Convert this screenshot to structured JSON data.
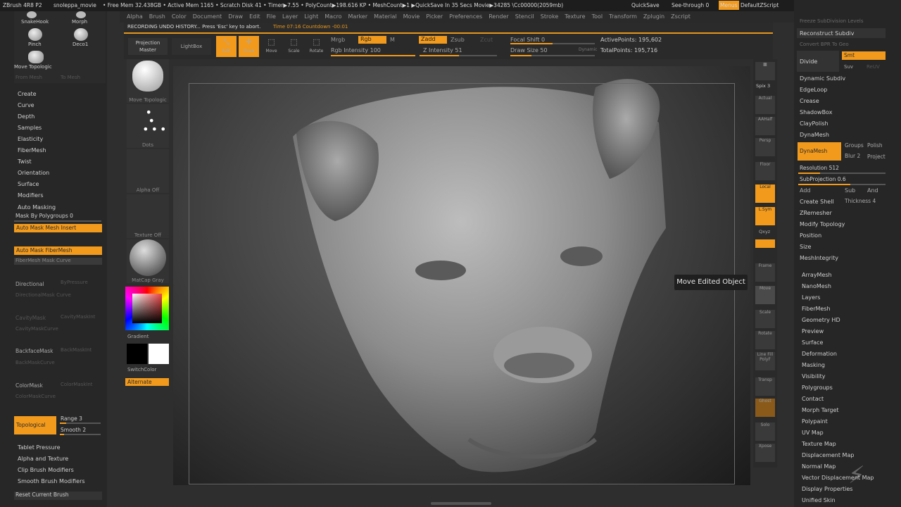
{
  "titlebar": {
    "app": "ZBrush 4R8 P2",
    "project": "snoleppa_movie",
    "stats": "• Free Mem 32.438GB • Active Mem 1165 • Scratch Disk 41 • Timer▶7.55 • PolyCount▶198.616 KP • MeshCount▶1 ▶QuickSave In 35 Secs Movie▶34285 \\Cc00000(2059mb)",
    "quicksave": "QuickSave",
    "see_through": "See-through 0",
    "menus": "Menus",
    "zscript": "DefaultZScript"
  },
  "menu": [
    "Alpha",
    "Brush",
    "Color",
    "Document",
    "Draw",
    "Edit",
    "File",
    "Layer",
    "Light",
    "Macro",
    "Marker",
    "Material",
    "Movie",
    "Picker",
    "Preferences",
    "Render",
    "Stencil",
    "Stroke",
    "Texture",
    "Tool",
    "Transform",
    "Zplugin",
    "Zscript"
  ],
  "recording": {
    "text": "RECORDING UNDO HISTORY... Press 'Esc' key to abort.",
    "timer": "Time 07:16  Countdown -00:01"
  },
  "toolbar": {
    "projection_master": "Projection Master",
    "lightbox": "LightBox",
    "edit": "Edit",
    "draw": "Draw",
    "move": "Move",
    "scale": "Scale",
    "rotate": "Rotate",
    "mrgb": "Mrgb",
    "rgb": "Rgb",
    "m": "M",
    "rgb_intensity": "Rgb Intensity 100",
    "zadd": "Zadd",
    "zsub": "Zsub",
    "zcut": "Zcut",
    "z_intensity": "Z Intensity 51",
    "focal_shift": "Focal Shift 0",
    "draw_size": "Draw Size 50",
    "dynamic": "Dynamic",
    "active_points": "ActivePoints: 195,602",
    "total_points": "TotalPoints: 195,716"
  },
  "leftpanel": {
    "top_brushes": [
      "SnakeHook",
      "Morph",
      "Pinch",
      "Deco1",
      "Move Topologic"
    ],
    "from_mesh": "From Mesh",
    "to_mesh": "To Mesh",
    "items": [
      "Create",
      "Curve",
      "Depth",
      "Samples",
      "Elasticity",
      "FiberMesh",
      "Twist",
      "Orientation",
      "Surface",
      "Modifiers",
      "Auto Masking"
    ],
    "mask_by_polygroups": "Mask By Polygroups 0",
    "auto_mask_mesh_insert": "Auto Mask Mesh Insert",
    "auto_mask_fibermesh": "Auto Mask FiberMesh",
    "fibermesh_mask_curve": "FiberMesh Mask Curve",
    "directional": "Directional",
    "by_pressure": "ByPressure",
    "directional_mask_curve": "DirectionalMask Curve",
    "cavity_mask": "CavityMask",
    "cavity_maskint": "CavityMaskInt",
    "cavity_mask_curve": "CavityMaskCurve",
    "backface_mask": "BackfaceMask",
    "backface_maskint": "BackMaskInt",
    "backmask_curve": "BackMaskCurve",
    "color_mask": "ColorMask",
    "color_maskint": "ColorMaskInt",
    "color_mask_curve": "ColorMaskCurve",
    "topological": "Topological",
    "range": "Range 3",
    "smooth": "Smooth 2",
    "bottom": [
      "Tablet Pressure",
      "Alpha and Texture",
      "Clip Brush Modifiers",
      "Smooth Brush Modifiers"
    ],
    "reset_brush": "Reset Current Brush"
  },
  "col2": {
    "brush": "Move Topologic",
    "stroke": "Dots",
    "alpha": "Alpha Off",
    "texture": "Texture Off",
    "material": "MatCap Gray",
    "gradient": "Gradient",
    "switch_color": "SwitchColor",
    "alternate": "Alternate"
  },
  "shelf": [
    "Spix 3",
    "Actual",
    "AAHalf",
    "Persp",
    "Floor",
    "Local",
    "L.Sym",
    "Qxyz",
    "Frame",
    "Move",
    "Scale",
    "Rotate",
    "Line Fill PolyF",
    "Transp",
    "Ghost",
    "Solo",
    "Xpose"
  ],
  "rightpanel": {
    "freeze_subdiv": "Freeze SubDivision Levels",
    "reconstruct_subdiv": "Reconstruct Subdiv",
    "convert_bpr": "Convert BPR To Geo",
    "divide": "Divide",
    "smt": "Smt",
    "suv": "Suv",
    "reuv": "ReUV",
    "items": [
      "Dynamic Subdiv",
      "EdgeLoop",
      "Crease",
      "ShadowBox",
      "ClayPolish",
      "DynaMesh"
    ],
    "dynamesh_btn": "DynaMesh",
    "groups": "Groups",
    "polish": "Polish",
    "blur": "Blur 2",
    "project": "Project",
    "resolution": "Resolution 512",
    "subprojection": "SubProjection 0.6",
    "add": "Add",
    "sub": "Sub",
    "and": "And",
    "create_shell": "Create Shell",
    "thickness": "Thickness 4",
    "items2": [
      "ZRemesher",
      "Modify Topology",
      "Position",
      "Size",
      "MeshIntegrity"
    ],
    "subpalettes": [
      "ArrayMesh",
      "NanoMesh",
      "Layers",
      "FiberMesh",
      "Geometry HD",
      "Preview",
      "Surface",
      "Deformation",
      "Masking",
      "Visibility",
      "Polygroups",
      "Contact",
      "Morph Target",
      "Polypaint",
      "UV Map",
      "Texture Map",
      "Displacement Map",
      "Normal Map",
      "Vector Displacement Map",
      "Display Properties",
      "Unified Skin"
    ]
  },
  "tooltip": "Move Edited Object",
  "colors": {
    "accent": "#f29a1c",
    "panel": "#272727",
    "canvas": "#4a4a4a"
  }
}
